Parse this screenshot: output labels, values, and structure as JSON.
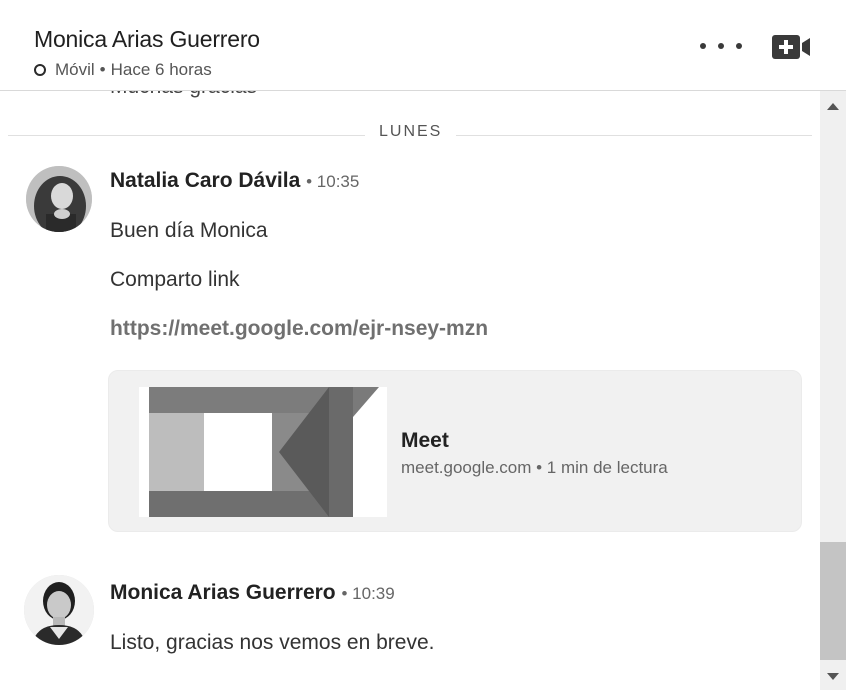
{
  "header": {
    "title": "Monica Arias Guerrero",
    "presence_device": "Móvil",
    "presence_separator": "•",
    "presence_time": "Hace 6 horas",
    "more_icon": "more-horizontal-icon",
    "video_icon": "video-call-icon"
  },
  "thread": {
    "cutoff_text": "Muchas gracias",
    "day_divider": "LUNES",
    "messages": [
      {
        "sender": "Natalia Caro Dávila",
        "time": "• 10:35",
        "lines": [
          "Buen día Monica",
          "Comparto link"
        ],
        "link": "https://meet.google.com/ejr-nsey-mzn",
        "preview": {
          "title": "Meet",
          "subtitle": "meet.google.com • 1 min de lectura"
        }
      },
      {
        "sender": "Monica Arias Guerrero",
        "time": "• 10:39",
        "lines": [
          "Listo, gracias nos vemos en breve."
        ]
      }
    ]
  },
  "colors": {
    "background": "#ffffff",
    "card_background": "#f1f1f1",
    "scrollbar_track": "#f0f0f0",
    "scrollbar_thumb": "#c4c4c4"
  }
}
